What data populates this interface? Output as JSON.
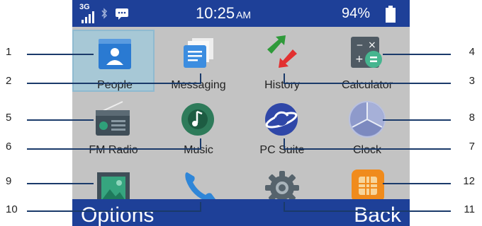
{
  "status_bar": {
    "network": "3G",
    "time": "10:25",
    "ampm": "AM",
    "battery": "94%"
  },
  "apps": [
    {
      "label": "People",
      "icon": "people-icon",
      "selected": true
    },
    {
      "label": "Messaging",
      "icon": "messaging-icon"
    },
    {
      "label": "History",
      "icon": "history-icon"
    },
    {
      "label": "Calculator",
      "icon": "calculator-icon"
    },
    {
      "label": "FM Radio",
      "icon": "radio-icon"
    },
    {
      "label": "Music",
      "icon": "music-icon"
    },
    {
      "label": "PC Suite",
      "icon": "pc-suite-icon"
    },
    {
      "label": "Clock",
      "icon": "clock-icon"
    },
    {
      "label": "",
      "icon": "gallery-icon"
    },
    {
      "label": "",
      "icon": "phone-icon"
    },
    {
      "label": "",
      "icon": "settings-icon"
    },
    {
      "label": "",
      "icon": "sim-icon"
    }
  ],
  "softkeys": {
    "left": "Options",
    "right": "Back"
  },
  "callouts": [
    "1",
    "2",
    "3",
    "4",
    "5",
    "6",
    "7",
    "8",
    "9",
    "10",
    "11",
    "12"
  ],
  "colors": {
    "bar": "#1e4098",
    "grid_bg": "#c3c3c3",
    "selection": "#a7c8d6"
  }
}
